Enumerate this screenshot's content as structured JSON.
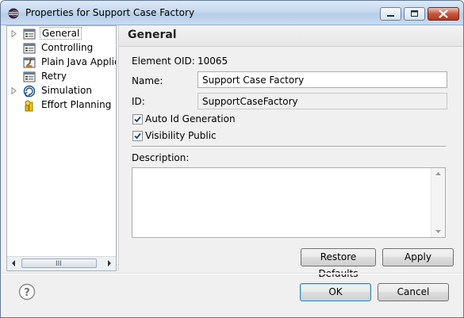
{
  "window": {
    "title": "Properties for Support Case Factory"
  },
  "tree": {
    "items": [
      {
        "label": "General",
        "icon": "general-page-icon",
        "expandable": true,
        "selected": true
      },
      {
        "label": "Controlling",
        "icon": "controlling-icon",
        "expandable": false
      },
      {
        "label": "Plain Java Applica",
        "icon": "java-app-icon",
        "expandable": false
      },
      {
        "label": "Retry",
        "icon": "retry-icon",
        "expandable": false
      },
      {
        "label": "Simulation",
        "icon": "simulation-icon",
        "expandable": true
      },
      {
        "label": "Effort Planning",
        "icon": "effort-planning-icon",
        "expandable": false
      }
    ],
    "scroll_grip": "III"
  },
  "page": {
    "title": "General",
    "element_oid_label": "Element OID:",
    "element_oid_value": "10065",
    "name_label": "Name:",
    "name_value": "Support Case Factory",
    "id_label": "ID:",
    "id_value": "SupportCaseFactory",
    "auto_id_label": "Auto Id Generation",
    "auto_id_checked": true,
    "visibility_label": "Visibility Public",
    "visibility_checked": true,
    "description_label": "Description:",
    "description_value": ""
  },
  "buttons": {
    "restore_defaults": "Restore Defaults",
    "apply": "Apply",
    "ok": "OK",
    "cancel": "Cancel"
  },
  "colors": {
    "titlebar": "#c6d9ef",
    "default_button_border": "#3c7fb1",
    "close_button": "#c9533c"
  }
}
